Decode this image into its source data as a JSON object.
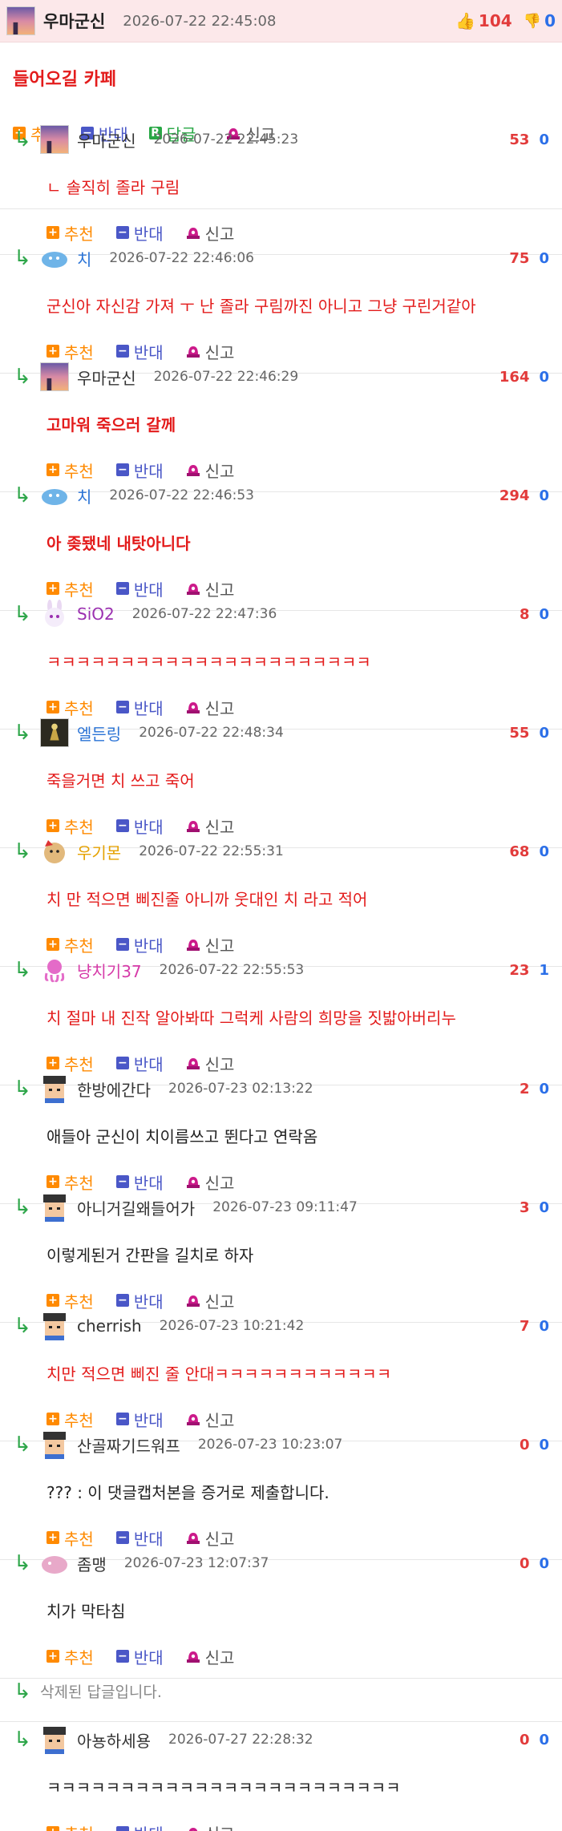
{
  "post": {
    "nickname": "우마군신",
    "time": "2026-07-22 22:45:08",
    "up": "104",
    "down": "0",
    "title": "들어오길 카페",
    "actions": {
      "recommend": "추천",
      "oppose": "반대",
      "reply": "답글",
      "report": "신고"
    }
  },
  "action_labels": {
    "recommend": "추천",
    "oppose": "반대",
    "report": "신고"
  },
  "comments": [
    {
      "nickname": "우마군신",
      "nick_color": "#333333",
      "time": "2026-07-22 22:45:23",
      "up": "53",
      "down": "0",
      "text": "ㄴ 솔직히 졸라 구림",
      "bold": false,
      "color": "red",
      "avatar": "sunset"
    },
    {
      "nickname": "치",
      "nick_color": "#2a73d6",
      "time": "2026-07-22 22:46:06",
      "up": "75",
      "down": "0",
      "text": "군신아 자신감 가져 ㅜ 난 졸라 구림까진 아니고 그냥 구린거같아",
      "bold": false,
      "color": "red",
      "avatar": "blob"
    },
    {
      "nickname": "우마군신",
      "nick_color": "#333333",
      "time": "2026-07-22 22:46:29",
      "up": "164",
      "down": "0",
      "text": "고마워 죽으러 갈께",
      "bold": true,
      "color": "red",
      "avatar": "sunset"
    },
    {
      "nickname": "치",
      "nick_color": "#2a73d6",
      "time": "2026-07-22 22:46:53",
      "up": "294",
      "down": "0",
      "text": "아 좆됐네 내탓아니다",
      "bold": true,
      "color": "red",
      "avatar": "blob"
    },
    {
      "nickname": "SiO2",
      "nick_color": "#9b30b0",
      "time": "2026-07-22 22:47:36",
      "up": "8",
      "down": "0",
      "text": "ㅋㅋㅋㅋㅋㅋㅋㅋㅋㅋㅋㅋㅋㅋㅋㅋㅋㅋㅋㅋㅋㅋ",
      "bold": false,
      "color": "red",
      "avatar": "bunny"
    },
    {
      "nickname": "엘든링",
      "nick_color": "#2a73d6",
      "time": "2026-07-22 22:48:34",
      "up": "55",
      "down": "0",
      "text": "죽을거면 치 쓰고 죽어",
      "bold": false,
      "color": "red",
      "avatar": "castle"
    },
    {
      "nickname": "우기몬",
      "nick_color": "#e5a100",
      "time": "2026-07-22 22:55:31",
      "up": "68",
      "down": "0",
      "text": "치 만 적으면 삐진줄 아니까 웃대인 치 라고 적어",
      "bold": false,
      "color": "red",
      "avatar": "dog"
    },
    {
      "nickname": "냥치기37",
      "nick_color": "#d63aa8",
      "time": "2026-07-22 22:55:53",
      "up": "23",
      "down": "1",
      "text": "치 절마 내 진작 알아봐따 그럭케 사람의 희망을 짓밟아버리누",
      "bold": false,
      "color": "red",
      "avatar": "octo"
    },
    {
      "nickname": "한방에간다",
      "nick_color": "#333333",
      "time": "2026-07-23 02:13:22",
      "up": "2",
      "down": "0",
      "text": "애들아 군신이 치이름쓰고 뛴다고 연락옴",
      "bold": false,
      "color": "black",
      "avatar": "pixel"
    },
    {
      "nickname": "아니거길왜들어가",
      "nick_color": "#333333",
      "time": "2026-07-23 09:11:47",
      "up": "3",
      "down": "0",
      "text": "이렇게된거 간판을 길치로 하자",
      "bold": false,
      "color": "black",
      "avatar": "pixel"
    },
    {
      "nickname": "cherrish",
      "nick_color": "#333333",
      "time": "2026-07-23 10:21:42",
      "up": "7",
      "down": "0",
      "text": "치만 적으면 삐진 줄 안대ㅋㅋㅋㅋㅋㅋㅋㅋㅋㅋㅋㅋ",
      "bold": false,
      "color": "red",
      "avatar": "pixel"
    },
    {
      "nickname": "산골짜기드워프",
      "nick_color": "#333333",
      "time": "2026-07-23 10:23:07",
      "up": "0",
      "down": "0",
      "text": "??? : 이 댓글캡처본을 증거로 제출합니다.",
      "bold": false,
      "color": "black",
      "avatar": "pixel"
    },
    {
      "nickname": "좀맹",
      "nick_color": "#333333",
      "time": "2026-07-23 12:07:37",
      "up": "0",
      "down": "0",
      "text": "치가 막타침",
      "bold": false,
      "color": "black",
      "avatar": "pink"
    }
  ],
  "deleted_text": "삭제된 답글입니다.",
  "last_comment": {
    "nickname": "아뇽하세용",
    "nick_color": "#333333",
    "time": "2026-07-27 22:28:32",
    "up": "0",
    "down": "0",
    "text": "ㅋㅋㅋㅋㅋㅋㅋㅋㅋㅋㅋㅋㅋㅋㅋㅋㅋㅋㅋㅋㅋㅋㅋㅋ",
    "bold": false,
    "color": "black",
    "avatar": "pixel"
  }
}
